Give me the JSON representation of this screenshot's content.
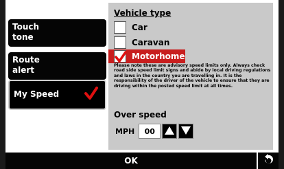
{
  "menu": {
    "items": [
      {
        "label": "Touch\ntone",
        "selected": false
      },
      {
        "label": "Route\nalert",
        "selected": false
      },
      {
        "label": "My Speed",
        "selected": true
      }
    ]
  },
  "vehicle": {
    "title": "Vehicle type",
    "options": [
      {
        "label": "Car",
        "checked": false
      },
      {
        "label": "Caravan",
        "checked": false
      },
      {
        "label": "Motorhome",
        "checked": true
      }
    ],
    "notice": "Please note these are advisory speed limits only. Always check road side speed limit signs and abide by local driving regulations and laws in the country you are travelling in. It is the responsibility of the driver of the vehicle to ensure  that they are driving within the posted speed limit at all times."
  },
  "overspeed": {
    "title": "Over speed",
    "unit": "MPH",
    "value": "00"
  },
  "footer": {
    "ok_label": "OK"
  },
  "colors": {
    "accent": "#c81e1e",
    "panel": "#c9c9c9",
    "button": "#050505"
  },
  "icons": {
    "check": "check-icon",
    "up": "arrow-up-icon",
    "down": "arrow-down-icon",
    "back": "back-icon"
  }
}
